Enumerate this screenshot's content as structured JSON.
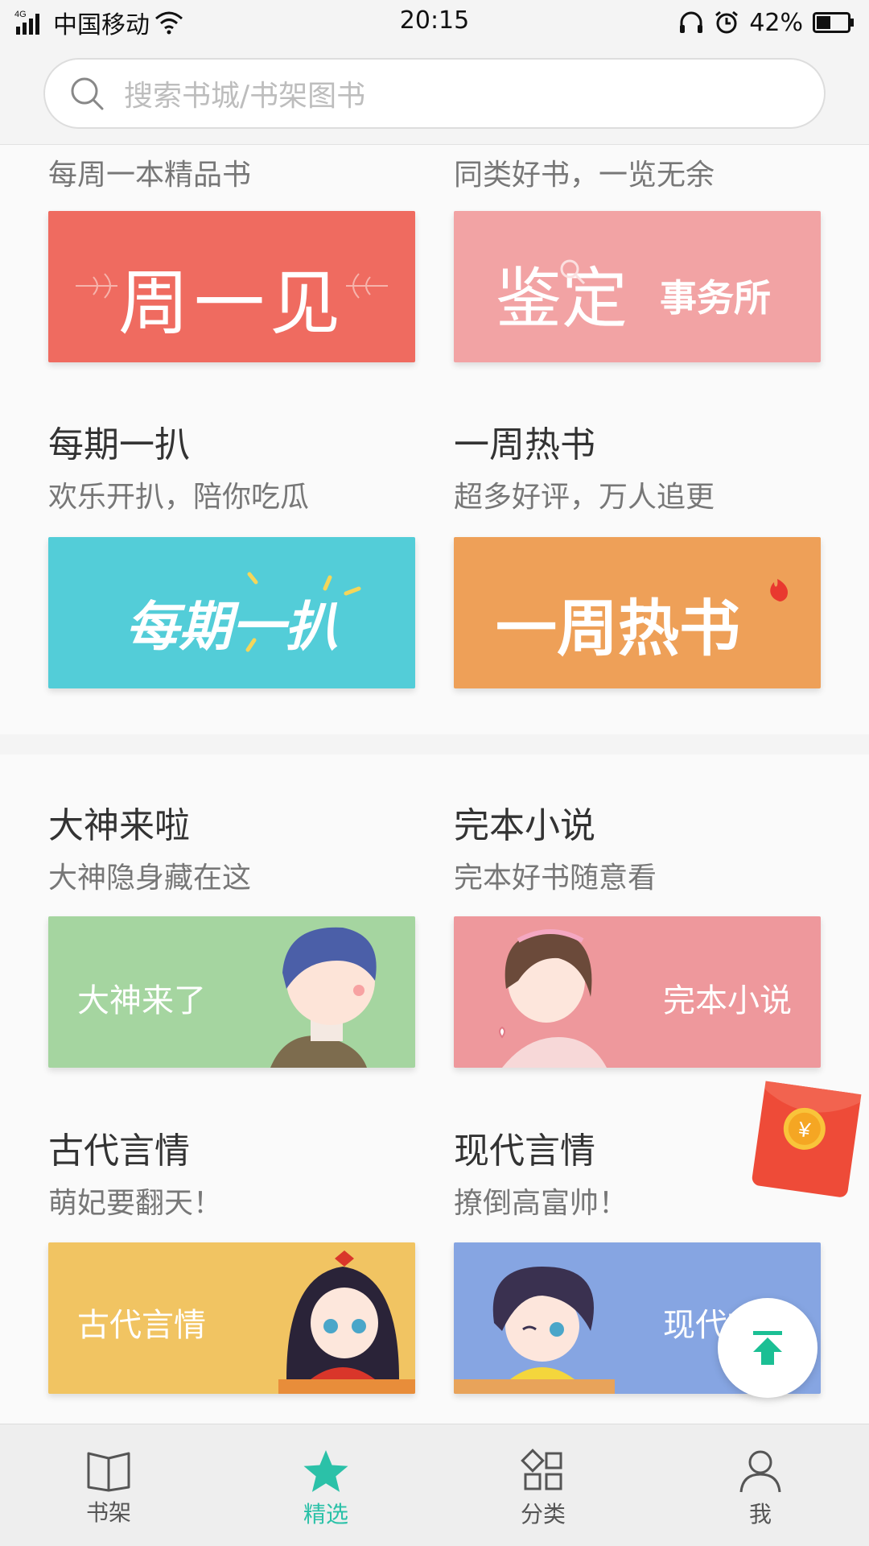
{
  "status_bar": {
    "network": "4G",
    "carrier": "中国移动",
    "time": "20:15",
    "battery": "42%"
  },
  "search": {
    "placeholder": "搜索书城/书架图书"
  },
  "section1": {
    "left_top_subtitle": "每周一本精品书",
    "right_top_subtitle": "同类好书，一览无余",
    "banner_zhouyijian": "周一见",
    "banner_jianding_a": "鉴定",
    "banner_jianding_b": "事务所",
    "left_title": "每期一扒",
    "left_subtitle": "欢乐开扒，陪你吃瓜",
    "right_title": "一周热书",
    "right_subtitle": "超多好评，万人追更",
    "banner_meiqi": "每期一扒",
    "banner_yizhou": "一周热书"
  },
  "section2": {
    "left_title": "大神来啦",
    "left_subtitle": "大神隐身藏在这",
    "right_title": "完本小说",
    "right_subtitle": "完本好书随意看",
    "banner_dashen": "大神来了",
    "banner_wanben": "完本小说",
    "left_title2": "古代言情",
    "left_subtitle2": "萌妃要翻天！",
    "right_title2": "现代言情",
    "right_subtitle2": "撩倒高富帅！",
    "banner_gudai": "古代言情",
    "banner_xiandai": "现代言情"
  },
  "bottom_nav": [
    {
      "label": "书架",
      "icon": "book-icon"
    },
    {
      "label": "精选",
      "icon": "star-icon"
    },
    {
      "label": "分类",
      "icon": "category-icon"
    },
    {
      "label": "我",
      "icon": "person-icon"
    }
  ],
  "colors": {
    "accent": "#2bc1a8",
    "zhouyijian": "#ef6b60",
    "jianding": "#f2a3a4",
    "meiqi": "#53cdd8",
    "yizhou": "#eea058",
    "dashen": "#a5d5a0",
    "wanben": "#ee989c",
    "gudai": "#f1c462",
    "xiandai": "#86a5e2"
  },
  "floating": {
    "red_packet_symbol": "¥"
  }
}
